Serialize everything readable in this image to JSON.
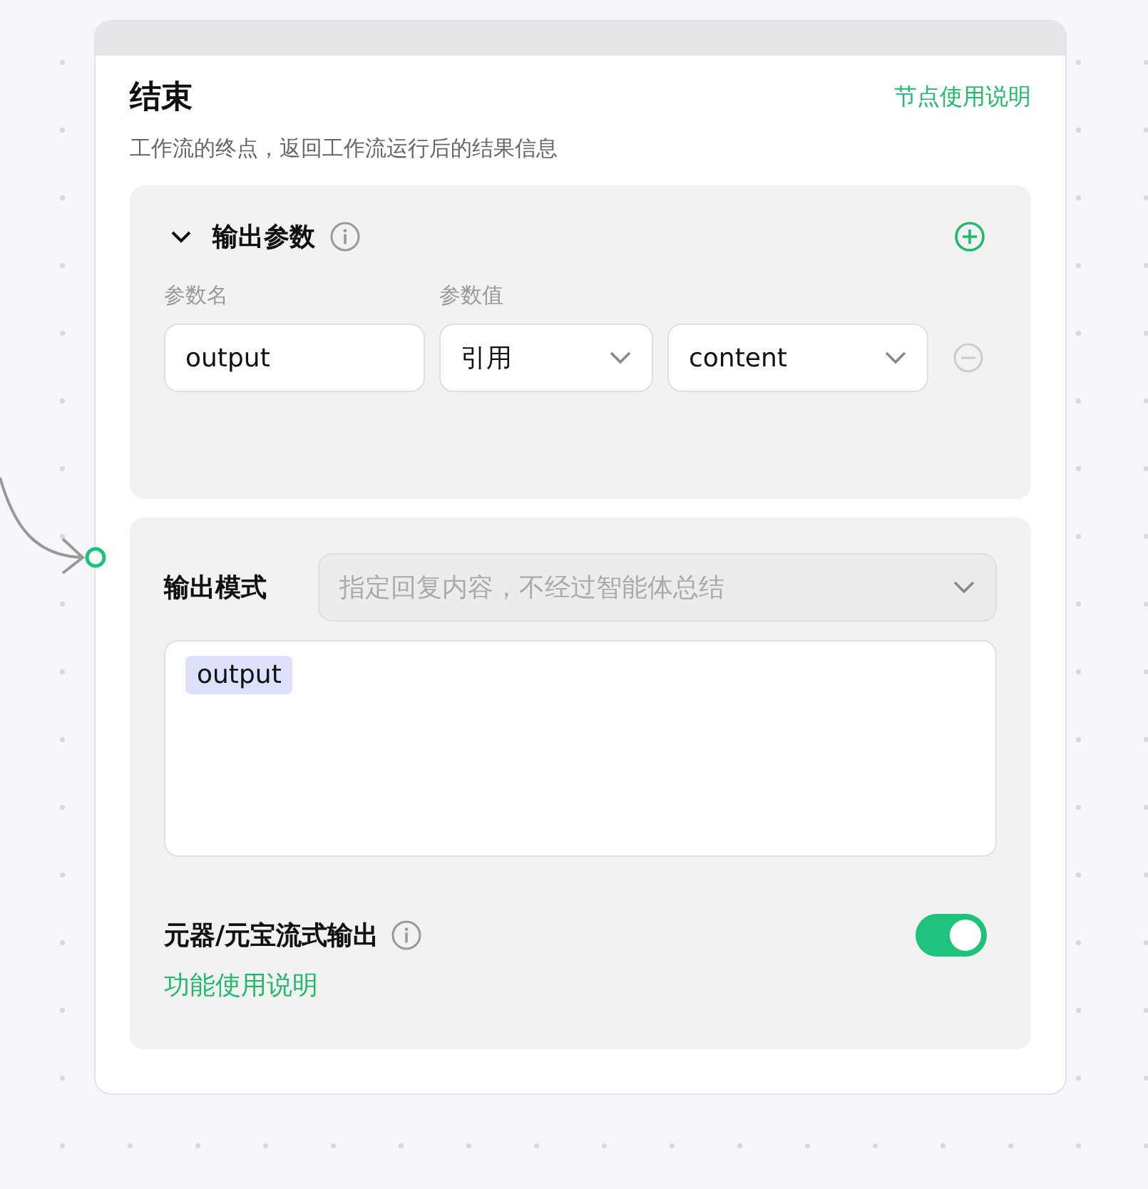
{
  "node": {
    "title": "结束",
    "help_link": "节点使用说明",
    "description": "工作流的终点，返回工作流运行后的结果信息"
  },
  "output_params": {
    "title": "输出参数",
    "expanded": true,
    "columns": [
      "参数名",
      "参数值"
    ],
    "rows": [
      {
        "name": "output",
        "source": "引用",
        "value": "content"
      }
    ]
  },
  "output_mode": {
    "label": "输出模式",
    "value": "指定回复内容，不经过智能体总结",
    "disabled": true,
    "content_tags": [
      "output"
    ]
  },
  "streaming": {
    "label": "元器/元宝流式输出",
    "on": true,
    "help_link": "功能使用说明"
  }
}
